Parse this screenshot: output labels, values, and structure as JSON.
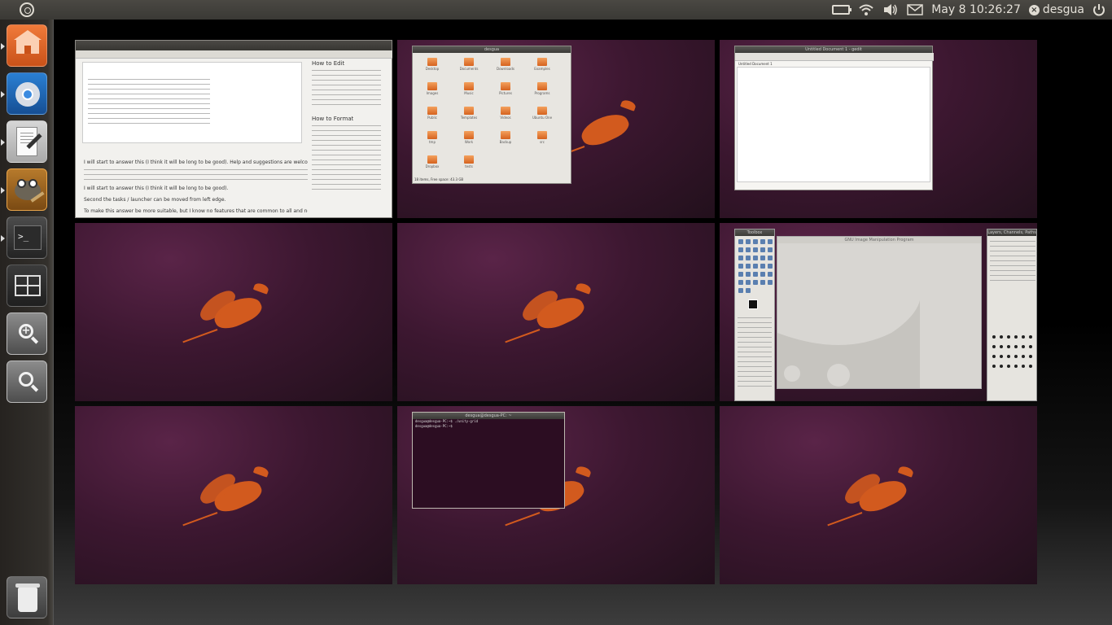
{
  "panel": {
    "datetime": "May 8 10:26:27",
    "user": "desgua",
    "indicator_icons": [
      "battery-icon",
      "wifi-icon",
      "volume-icon",
      "mail-icon",
      "user-status-icon",
      "power-icon"
    ]
  },
  "launcher": {
    "items": [
      {
        "name": "home-folder",
        "icon": "home-folder-icon"
      },
      {
        "name": "chromium-browser",
        "icon": "chromium-icon"
      },
      {
        "name": "text-editor",
        "icon": "text-editor-icon"
      },
      {
        "name": "gimp",
        "icon": "gimp-icon"
      },
      {
        "name": "terminal",
        "icon": "terminal-icon"
      },
      {
        "name": "workspace-switcher",
        "icon": "workspace-switcher-icon"
      },
      {
        "name": "zoom-in",
        "icon": "zoom-in-icon"
      },
      {
        "name": "zoom-out",
        "icon": "zoom-out-icon"
      },
      {
        "name": "trash",
        "icon": "trash-icon"
      }
    ]
  },
  "workspaces": {
    "count": 9,
    "browser": {
      "sidebar_heading_1": "How to Edit",
      "sidebar_heading_2": "How to Format",
      "body_line_1": "I will start to answer this (I think it will be long to be good). Help and suggestions are welcome.",
      "body_line_2": "I will start to answer this (I think it will be long to be good).",
      "body_line_3": "Second the tasks / launcher can be moved from left edge.",
      "body_line_4": "To make this answer be more suitable, but I know no features that are common to all and nothing"
    },
    "files": {
      "title": "desgua",
      "folders": [
        "Desktop",
        "Documents",
        "Downloads",
        "Examples",
        "Images",
        "Music",
        "Pictures",
        "Programs",
        "Public",
        "Templates",
        "Videos",
        "Ubuntu One",
        "tmp",
        "Work",
        "Backup",
        "src",
        "Dropbox",
        "tests"
      ],
      "status": "18 items, Free space: 43.3 GB"
    },
    "editor": {
      "title": "Untitled Document 1 - gedit",
      "tab": "Untitled Document 1"
    },
    "terminal": {
      "title": "desgua@desgua-PC: ~",
      "line_1": "desgua@desgua-PC:~$ ./unity-grid",
      "line_2": "desgua@desgua-PC:~$"
    },
    "gimp": {
      "toolbox_title": "Toolbox",
      "canvas_title": "GNU Image Manipulation Program",
      "dock_title": "Layers, Channels, Paths"
    }
  }
}
